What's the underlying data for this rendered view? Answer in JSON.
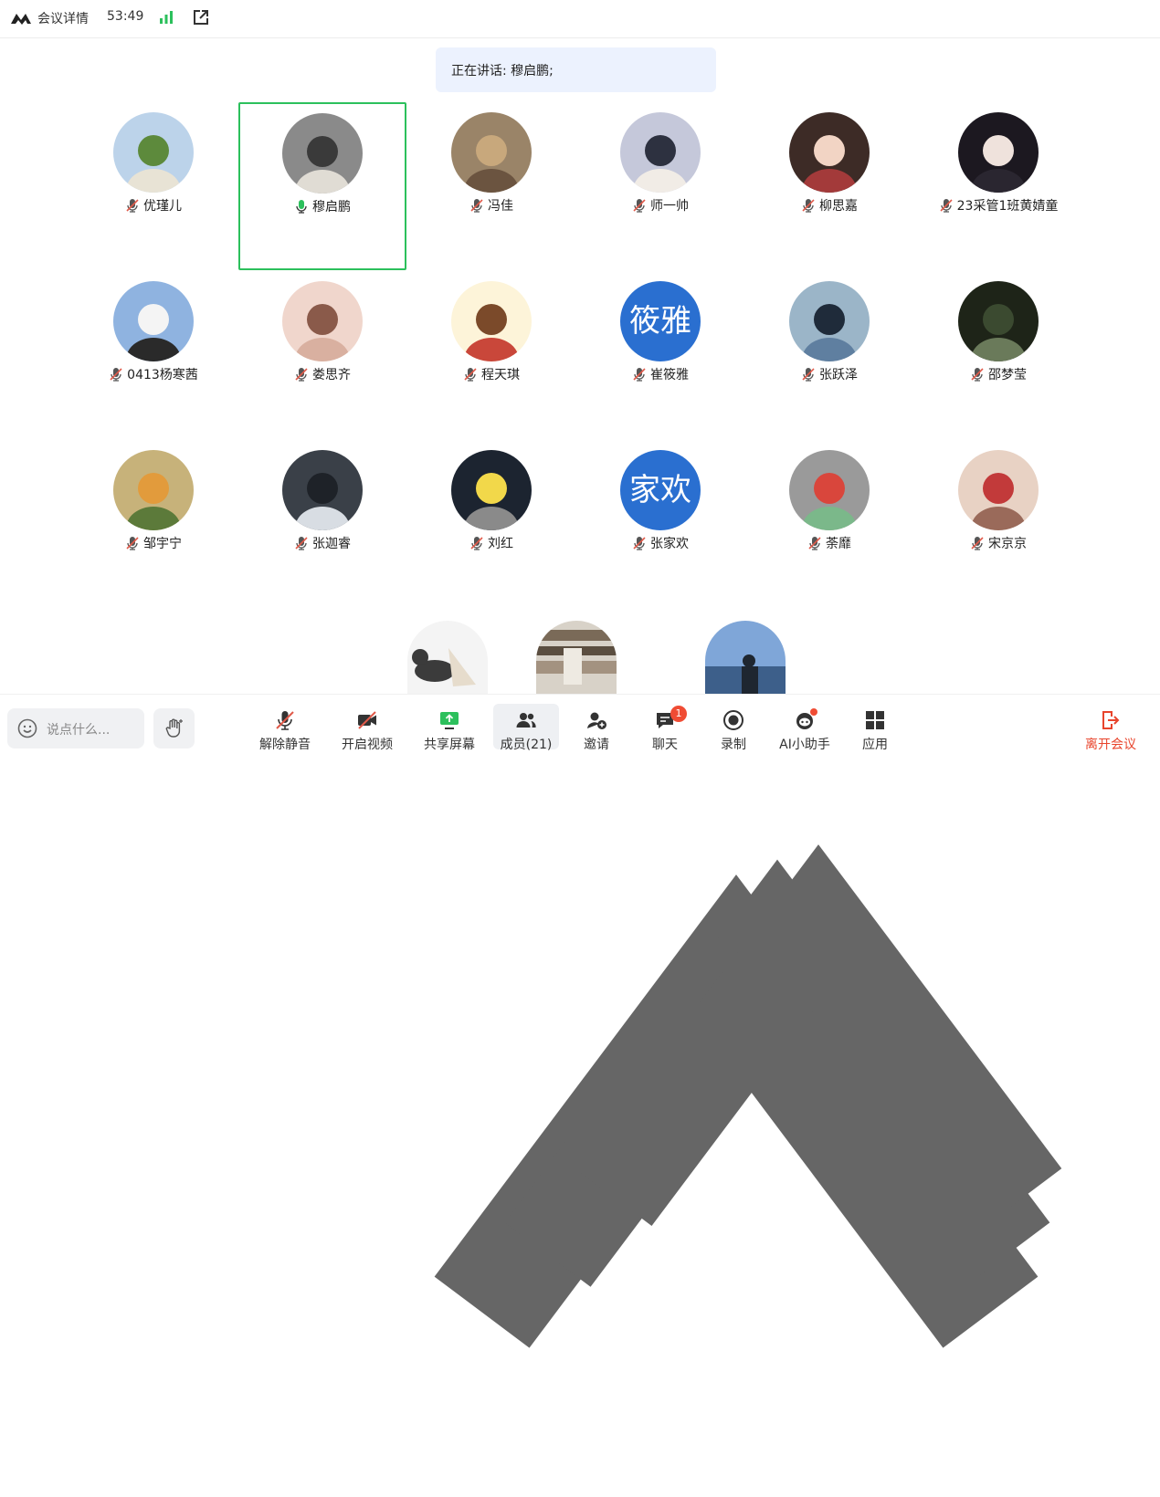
{
  "topbar": {
    "title": "会议详情",
    "timer": "53:49"
  },
  "speaking": "正在讲话: 穆启鹏;",
  "participants": [
    {
      "name": "优瑾儿"
    },
    {
      "name": "穆启鹏"
    },
    {
      "name": "冯佳"
    },
    {
      "name": "师一帅"
    },
    {
      "name": "柳思嘉"
    },
    {
      "name": "23采管1班黄婧童"
    },
    {
      "name": "0413杨寒茜"
    },
    {
      "name": "娄思齐"
    },
    {
      "name": "程天琪"
    },
    {
      "name": "崔筱雅",
      "avatar_text": "筱雅"
    },
    {
      "name": "张跃泽"
    },
    {
      "name": "邵梦莹"
    },
    {
      "name": "邹宇宁"
    },
    {
      "name": "张迦睿"
    },
    {
      "name": "刘红"
    },
    {
      "name": "张家欢",
      "avatar_text": "家欢"
    },
    {
      "name": "荼靡"
    },
    {
      "name": "宋京京"
    }
  ],
  "toolbar": {
    "chat_placeholder": "说点什么...",
    "unmute": "解除静音",
    "video": "开启视频",
    "share": "共享屏幕",
    "members": "成员(21)",
    "invite": "邀请",
    "chat": "聊天",
    "chat_badge": "1",
    "record": "录制",
    "ai": "AI小助手",
    "apps": "应用",
    "leave": "离开会议"
  },
  "colors": {
    "accent": "#2a6fd0",
    "speaking_border": "#2cc05c",
    "danger": "#e8442c",
    "muted_slash": "#e05a4a"
  }
}
